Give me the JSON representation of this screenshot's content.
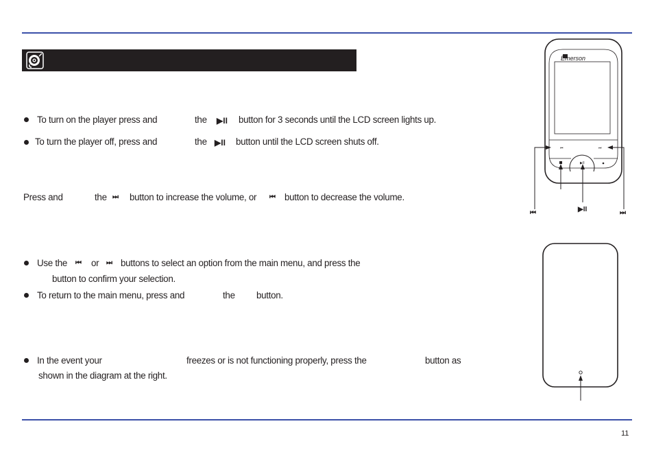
{
  "page": {
    "page_number": "11",
    "rule_color": "#3a4fa8",
    "header_bar_color": "#231f20"
  },
  "header": {
    "icon": "disc-icon",
    "title": ""
  },
  "power": {
    "bullets": [
      {
        "part1": "To turn on the player press and",
        "part2": "the",
        "icon": "play-pause-icon",
        "icon_glyph": "▶II",
        "part3": "button for 3 seconds until the LCD screen lights up."
      },
      {
        "part1": "To turn the player off, press and",
        "part2": "the",
        "icon": "play-pause-icon",
        "icon_glyph": "▶II",
        "part3": "button until the LCD screen shuts off."
      }
    ]
  },
  "volume": {
    "part1": "Press and",
    "part2": "the",
    "next_glyph": "⏭",
    "part3": "button to increase the volume, or",
    "prev_glyph": "⏮",
    "part4": "button to decrease the volume."
  },
  "menu": {
    "bullets": [
      {
        "part1": "Use the",
        "prev_glyph": "⏮",
        "part2": "or",
        "next_glyph": "⏭",
        "part3": "buttons to select an option from the main menu, and press the",
        "line2": "button to confirm your selection."
      },
      {
        "part1": "To return to the main menu, press and",
        "part2": "the",
        "part3": "button."
      }
    ]
  },
  "reset": {
    "part1": "In the event your",
    "part2": "freezes or is not functioning properly, press the",
    "part3": "button as",
    "line2": "shown in the diagram at the right."
  },
  "diagram_front": {
    "brand": "Emerson",
    "label_prev": "⏮",
    "label_play": "▶II",
    "label_next": "⏭"
  }
}
